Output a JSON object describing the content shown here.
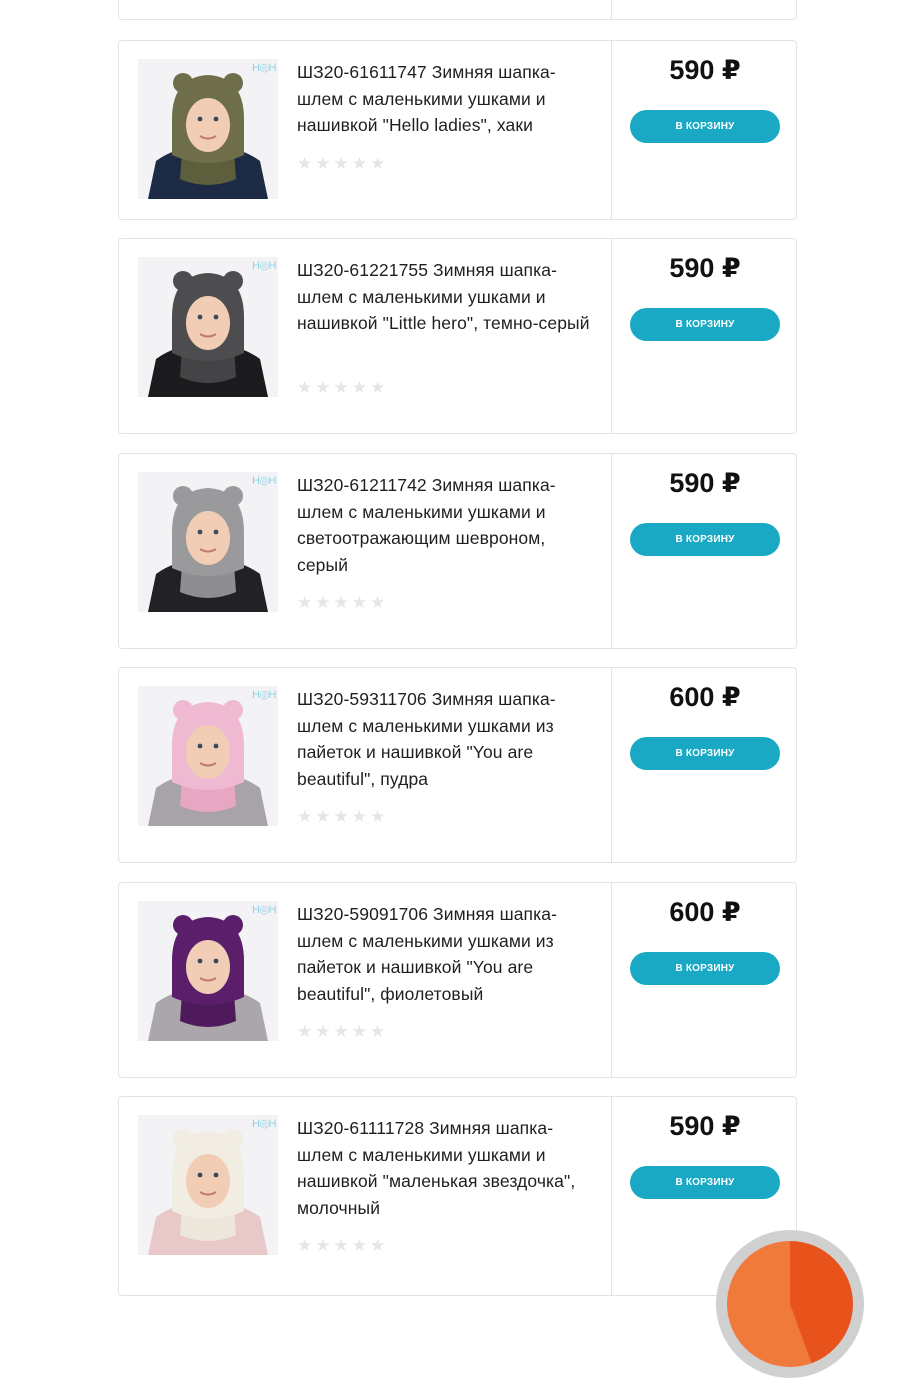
{
  "currency_symbol": "₽",
  "products": [
    {
      "title": "ШЗ20-61611747 Зимняя шапка-шлем с маленькими ушками и нашивкой \"Hello ladies\", хаки",
      "price": "590 ₽",
      "cart_label": "В КОРЗИНУ",
      "rating": 0,
      "hat_color": "#6e6f4a",
      "scarf_color": "#5d5e3c",
      "jacket_color": "#1e2b45"
    },
    {
      "title": "ШЗ20-61221755 Зимняя шапка-шлем с маленькими ушками и нашивкой \"Little hero\", темно-серый",
      "price": "590 ₽",
      "cart_label": "В КОРЗИНУ",
      "rating": 0,
      "hat_color": "#4d4d4f",
      "scarf_color": "#444446",
      "jacket_color": "#1b1b1d"
    },
    {
      "title": "ШЗ20-61211742 Зимняя шапка-шлем с маленькими ушками и светоотражающим шевроном, серый",
      "price": "590 ₽",
      "cart_label": "В КОРЗИНУ",
      "rating": 0,
      "hat_color": "#9a9a9c",
      "scarf_color": "#8e8e90",
      "jacket_color": "#222226"
    },
    {
      "title": "ШЗ20-59311706 Зимняя шапка-шлем с маленькими ушками из пайеток и нашивкой \"You are beautiful\", пудра",
      "price": "600 ₽",
      "cart_label": "В КОРЗИНУ",
      "rating": 0,
      "hat_color": "#efb9d2",
      "scarf_color": "#e7a7c3",
      "jacket_color": "#a7a3a8"
    },
    {
      "title": "ШЗ20-59091706 Зимняя шапка-шлем с маленькими ушками из пайеток и нашивкой \"You are beautiful\", фиолетовый",
      "price": "600 ₽",
      "cart_label": "В КОРЗИНУ",
      "rating": 0,
      "hat_color": "#5a1e6a",
      "scarf_color": "#4e1a5c",
      "jacket_color": "#aaa6ab"
    },
    {
      "title": "ШЗ20-61111728 Зимняя шапка-шлем с маленькими ушками и нашивкой \"маленькая звездочка\", молочный",
      "price": "590 ₽",
      "cart_label": "В КОРЗИНУ",
      "rating": 0,
      "hat_color": "#f1ede2",
      "scarf_color": "#ece7da",
      "jacket_color": "#e8c8c9"
    }
  ]
}
